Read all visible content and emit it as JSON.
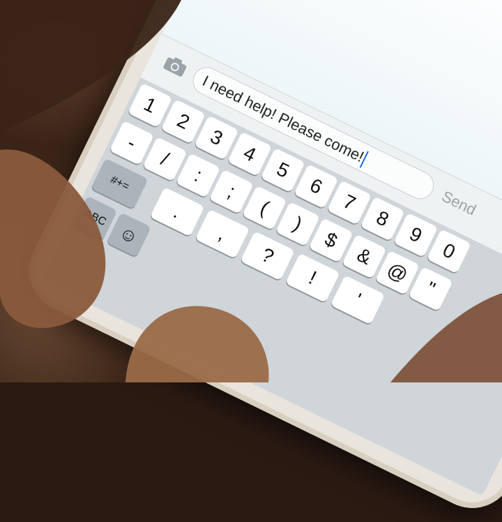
{
  "compose": {
    "message_text": "I need help! Please come!",
    "send_label": "Send"
  },
  "keyboard": {
    "row1": [
      "1",
      "2",
      "3",
      "4",
      "5",
      "6",
      "7",
      "8",
      "9",
      "0"
    ],
    "row2": [
      "-",
      "/",
      ":",
      ";",
      "(",
      ")",
      "$",
      "&",
      "@",
      "\""
    ],
    "row3_left": "#+=",
    "row3": [
      ".",
      ",",
      "?",
      "!",
      "'"
    ],
    "mode_key": "ABC"
  },
  "icons": {
    "camera": "camera-icon",
    "emoji": "emoji-icon"
  },
  "colors": {
    "cursor": "#1a6cf0",
    "key": "#ffffff",
    "keyboard_bg": "#cfd5d9"
  }
}
